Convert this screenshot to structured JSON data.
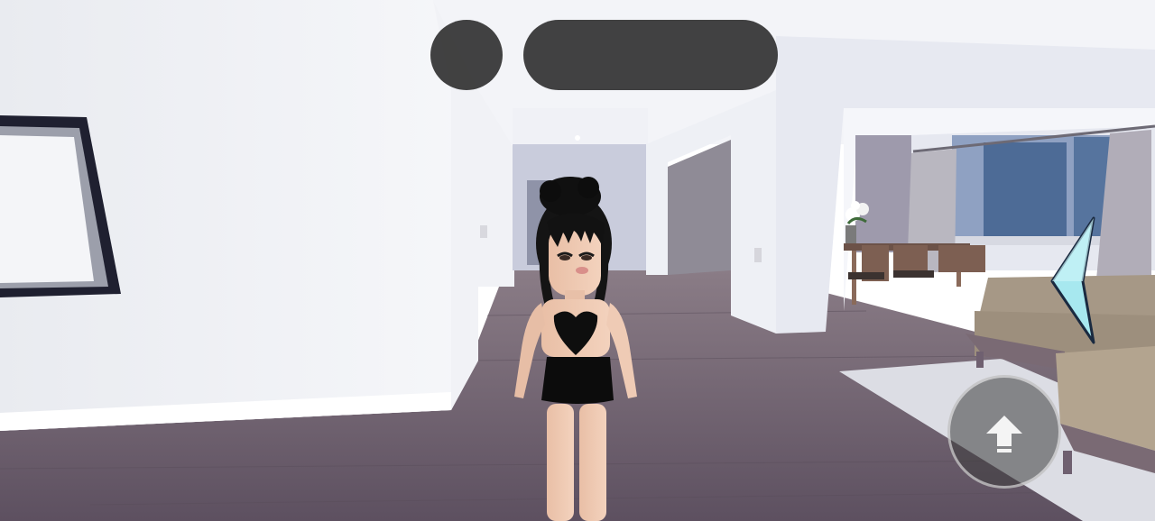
{
  "hud": {
    "menu_button": {
      "icon": "menu-icon"
    },
    "top_bar": {
      "label": ""
    }
  },
  "controls": {
    "side_arrow": {
      "icon": "triangle-left-icon",
      "color": "#a7e8ef"
    },
    "jump_button": {
      "icon": "arrow-up-icon"
    }
  },
  "colors": {
    "wall": "#eef0f4",
    "floor": "#6f6370",
    "ceiling": "#f7f8fb",
    "hud": "#282828"
  }
}
